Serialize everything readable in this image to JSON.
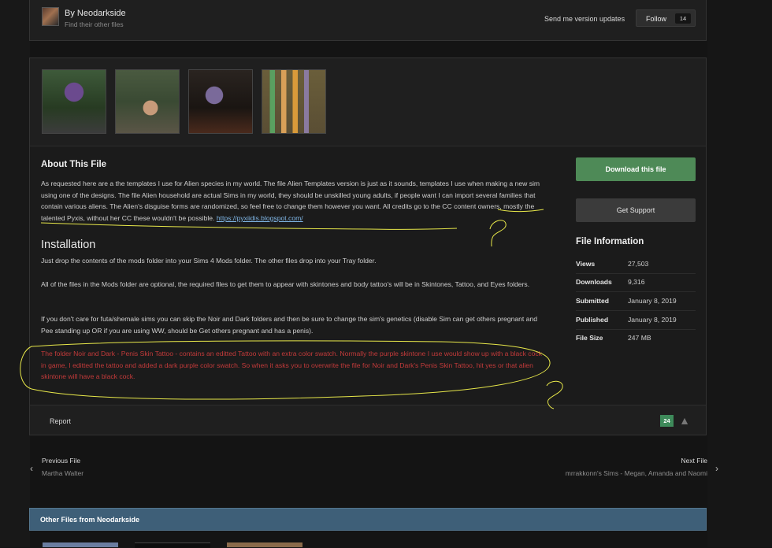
{
  "author": {
    "by": "By Neodarkside",
    "find": "Find their other files",
    "send_updates": "Send me version updates",
    "follow_label": "Follow",
    "follow_count": "14"
  },
  "about": {
    "title": "About This File",
    "text": "As requested here are a the templates I use for Alien species in my world. The file Alien Templates version is just as it sounds, templates I use when making a new sim using one of the designs. The file Alien household are actual Sims in my world, they should be unskilled young adults, if people want I can import several families that contain various aliens. The Alien's disguise forms are randomized, so feel free to change them however you want. All credits go to the CC content owners, mostly the talented Pyxis, without her CC these wouldn't be possible. ",
    "link": "https://pyxiidis.blogspot.com/"
  },
  "installation": {
    "title": "Installation",
    "p1": "Just drop the contents of the mods folder into your Sims 4 Mods folder. The other files drop into your Tray folder.",
    "p2": "All of the files in the Mods folder are optional, the required files to get them to appear with skintones and body tattoo's will be in Skintones, Tattoo, and Eyes folders.",
    "p3": "If you don't care for futa/shemale sims you can skip the Noir and Dark folders and then be sure to change the sim's genetics (disable Sim can get others pregnant and Pee standing up OR if you are using WW, should be Get others pregnant and has a penis).",
    "p4": "The folder Noir and Dark - Penis Skin Tattoo - contains an editted Tattoo with an extra color swatch. Normally the purple skintone I use would show up with a black cock in game, I editted the tattoo and added a dark purple color swatch. So when it asks you to overwrite the file for Noir and Dark's Penis Skin Tattoo, hit yes or that alien skintone will have a black cock."
  },
  "sidebar": {
    "download": "Download this file",
    "support": "Get Support",
    "info_title": "File Information",
    "rows": [
      {
        "key": "Views",
        "value": "27,503"
      },
      {
        "key": "Downloads",
        "value": "9,316"
      },
      {
        "key": "Submitted",
        "value": "January 8, 2019"
      },
      {
        "key": "Published",
        "value": "January 8, 2019"
      },
      {
        "key": "File Size",
        "value": "247 MB"
      }
    ]
  },
  "footer": {
    "report": "Report",
    "reputation": "24"
  },
  "nav": {
    "prev_label": "Previous File",
    "prev_title": "Martha Walter",
    "next_label": "Next File",
    "next_title": "mrrakkonn's Sims - Megan, Amanda and Naomi"
  },
  "other": {
    "title": "Other Files from Neodarkside"
  },
  "colors": {
    "background": "#141414",
    "panel": "#1f1f1f",
    "download_button": "#4e8a57",
    "warning_text": "#c23a3a",
    "other_header": "#3e5f78",
    "annotation": "#e8e84a"
  }
}
